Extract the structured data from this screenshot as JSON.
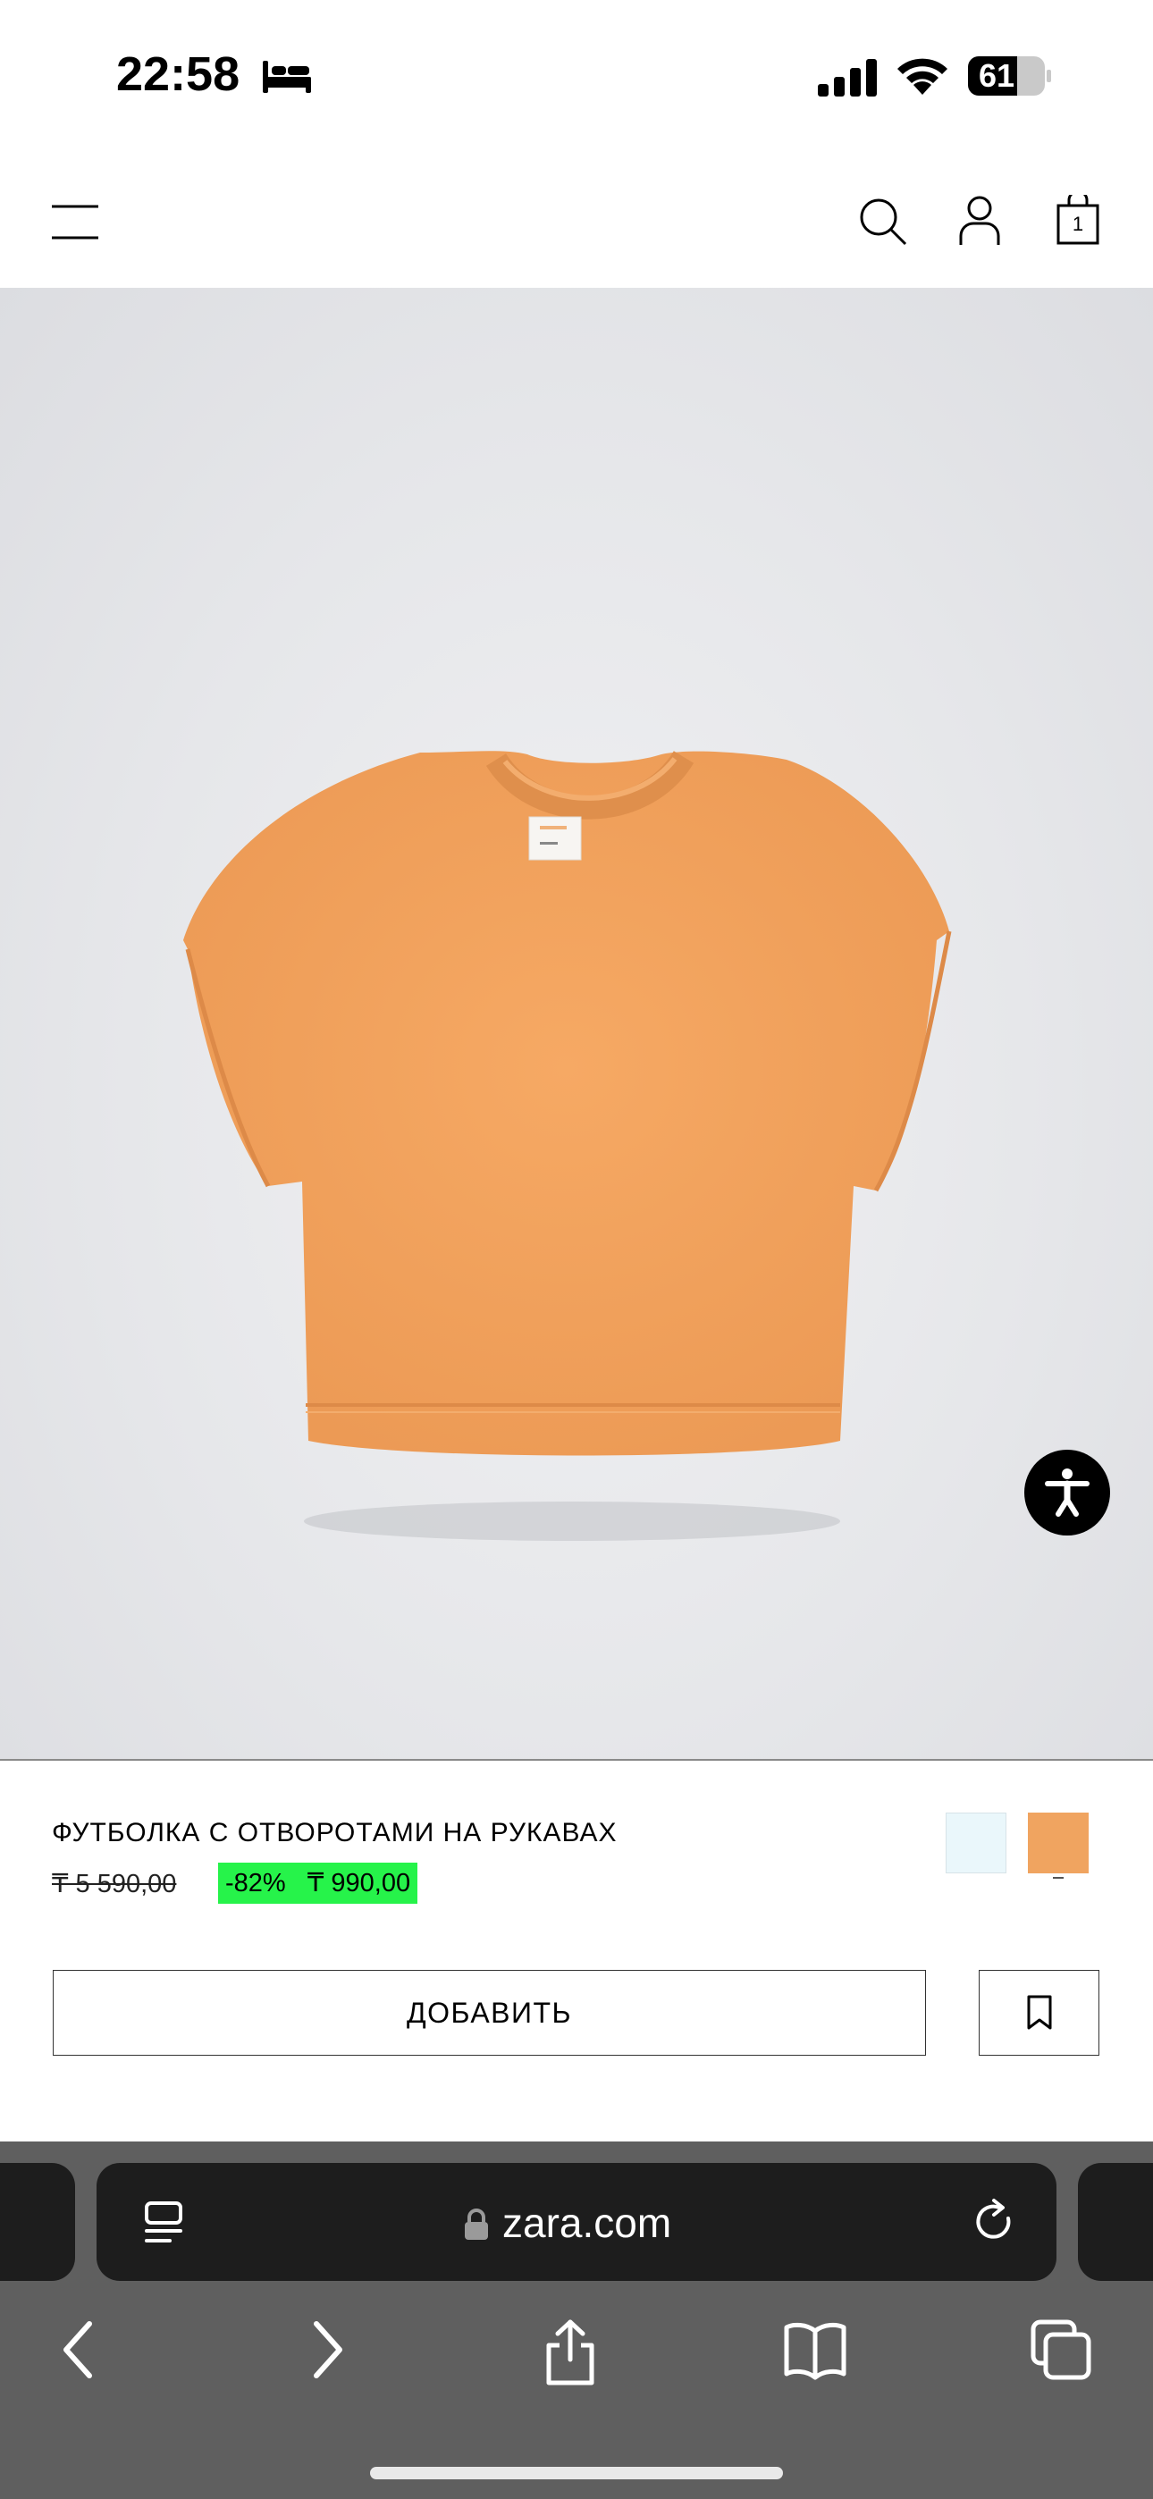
{
  "status_bar": {
    "time": "22:58",
    "battery_level": "61",
    "icons": [
      "sleep-bed-icon",
      "cellular-signal-icon",
      "wifi-icon",
      "battery-icon"
    ]
  },
  "header": {
    "icons": [
      "menu-icon",
      "search-icon",
      "user-icon",
      "shopping-bag-icon"
    ],
    "bag_count": "1"
  },
  "product": {
    "image_subject": "orange t-shirt",
    "title": "ФУТБОЛКА С ОТВОРОТАМИ НА РУКАВАХ",
    "old_price": "₸ 5 590,00",
    "discount": "-82%",
    "new_price": "₸ 990,00",
    "colors": [
      {
        "name": "light-blue",
        "hex": "#eaf7fb",
        "selected": false
      },
      {
        "name": "orange",
        "hex": "#f0a460",
        "selected": true
      }
    ]
  },
  "actions": {
    "add_label": "ДОБАВИТЬ",
    "bookmark_icon": "bookmark-icon",
    "accessibility_icon": "accessibility-icon"
  },
  "browser": {
    "url": "zara.com",
    "icons": [
      "reader-icon",
      "lock-icon",
      "reload-icon",
      "back-icon",
      "forward-icon",
      "share-icon",
      "bookmarks-icon",
      "tabs-icon"
    ]
  },
  "colors": {
    "discount_badge": "#26f34a",
    "product_orange": "#f0a460",
    "browser_bar": "#1d1d1d"
  }
}
